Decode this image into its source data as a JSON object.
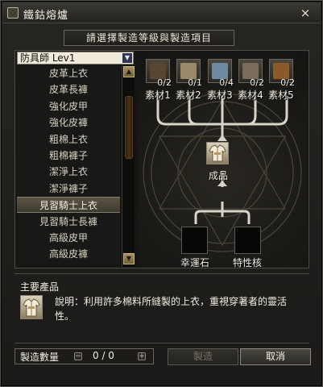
{
  "window": {
    "title": "鐵鈷熔爐",
    "close_glyph": "×"
  },
  "prompt": "請選擇製造等級與製造項目",
  "category_select": {
    "value": "防具師 Lev1",
    "arrow": "▼"
  },
  "item_list": {
    "items": [
      "皮革上衣",
      "皮革長褲",
      "強化皮甲",
      "強化皮褲",
      "粗棉上衣",
      "粗棉褲子",
      "潔淨上衣",
      "潔淨褲子",
      "見習騎士上衣",
      "見習騎士長褲",
      "高級皮甲",
      "高級皮褲"
    ],
    "selected_index": 8
  },
  "scrollbar": {
    "up_glyph": "▲",
    "down_glyph": "▼"
  },
  "materials": [
    {
      "label": "素材1",
      "count": "0/2",
      "color": "#5a4530"
    },
    {
      "label": "素材2",
      "count": "0/1",
      "color": "#9a8a6a"
    },
    {
      "label": "素材3",
      "count": "0/4",
      "color": "#6f8aa0"
    },
    {
      "label": "素材4",
      "count": "0/2",
      "color": "#7a6e5a"
    },
    {
      "label": "素材5",
      "count": "0/2",
      "color": "#8a5a2a"
    }
  ],
  "product": {
    "label": "成品"
  },
  "extra_slots": {
    "luck_stone": "幸運石",
    "trait_core": "特性核"
  },
  "main_product": {
    "title": "主要產品",
    "description": "說明：利用許多棉料所縫製的上衣，重視穿著者的靈活性。"
  },
  "quantity": {
    "label": "製造數量",
    "value": "0 / 0",
    "minus": "−",
    "plus": "+"
  },
  "buttons": {
    "craft": "製造",
    "cancel": "取消"
  }
}
